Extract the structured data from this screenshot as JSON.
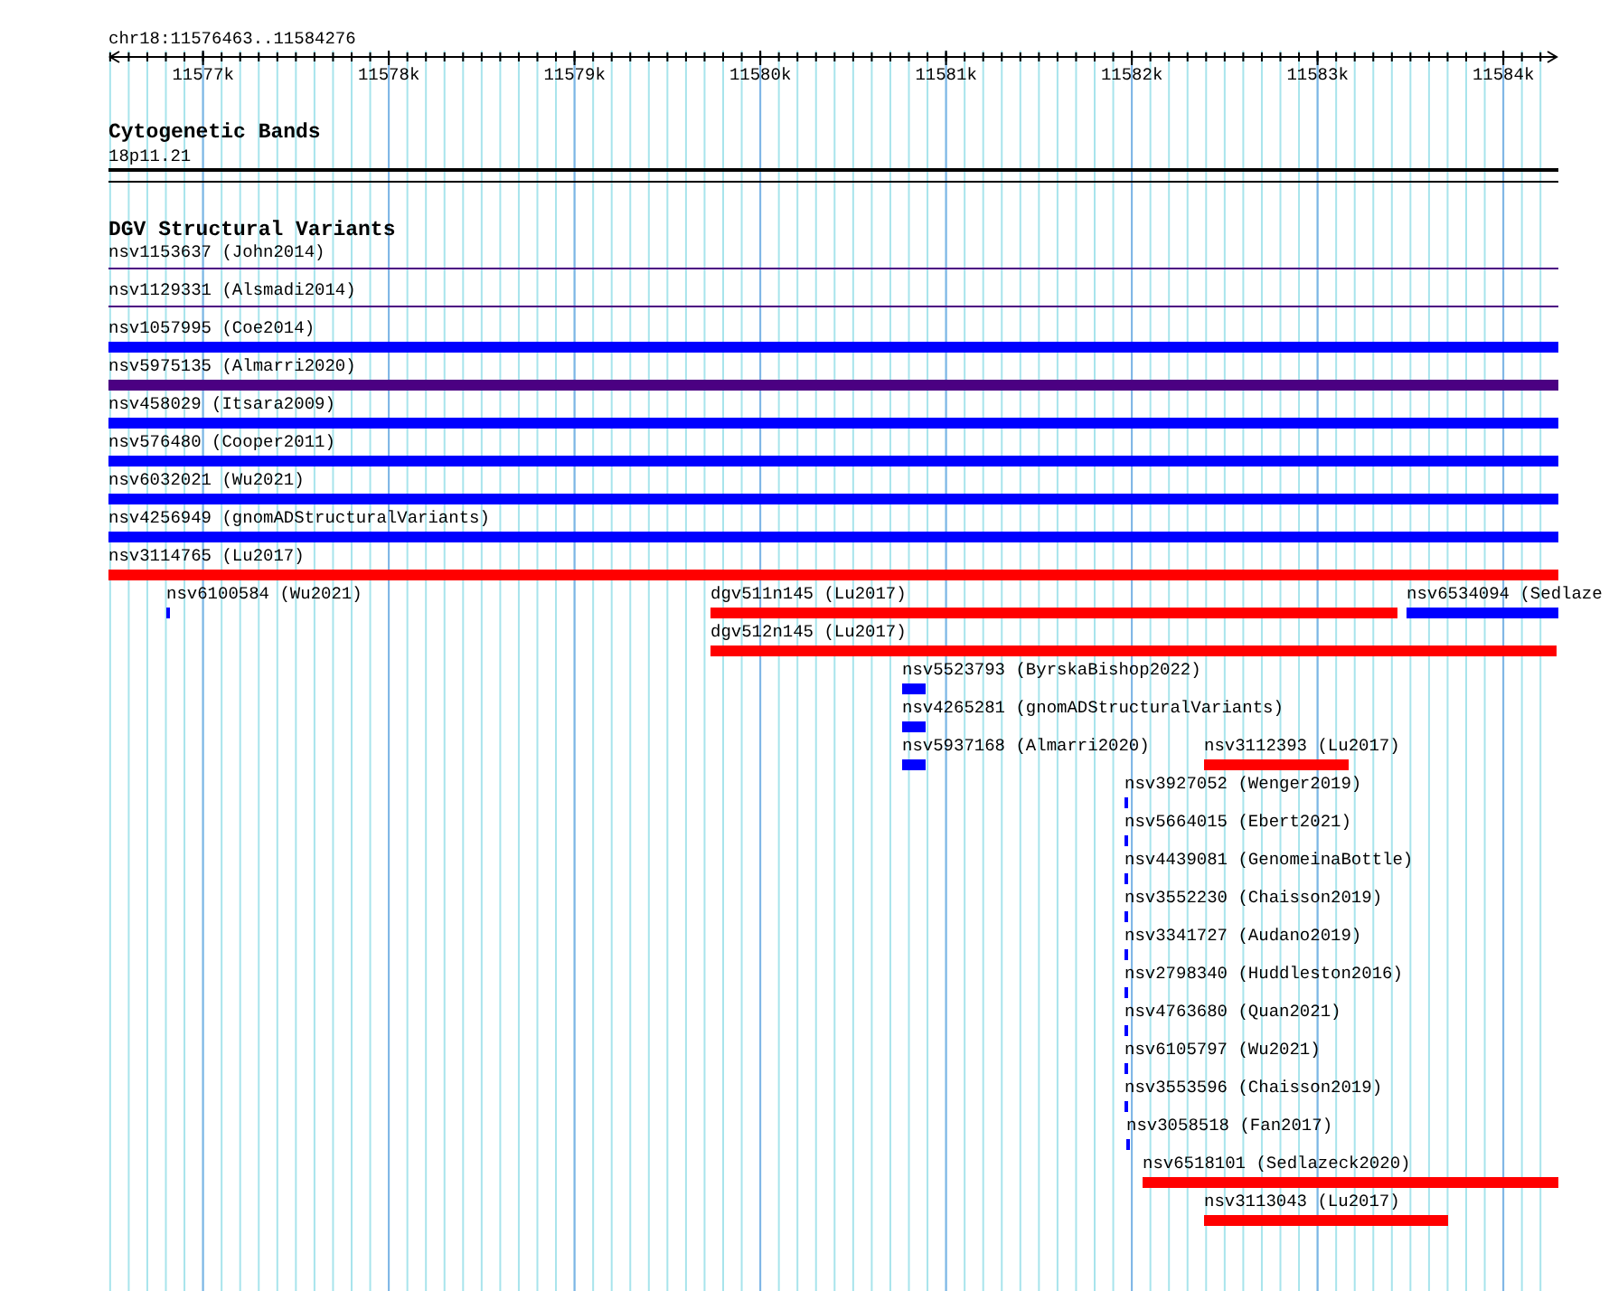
{
  "ruler": {
    "location": "chr18:11576463..11584276",
    "ticks": [
      "11577k",
      "11578k",
      "11579k",
      "11580k",
      "11581k",
      "11582k",
      "11583k",
      "11584k"
    ]
  },
  "cytoband_track": {
    "title": "Cytogenetic Bands",
    "band": "18p11.21"
  },
  "dgv_track": {
    "title": "DGV Structural Variants",
    "features": [
      {
        "label": "nsv1153637 (John2014)",
        "kind": "line",
        "color": "#4b0082"
      },
      {
        "label": "nsv1129331 (Alsmadi2014)",
        "kind": "line",
        "color": "#4b0082"
      },
      {
        "label": "nsv1057995 (Coe2014)",
        "kind": "bar",
        "color": "#0000ff"
      },
      {
        "label": "nsv5975135 (Almarri2020)",
        "kind": "bar",
        "color": "#4b0082"
      },
      {
        "label": "nsv458029 (Itsara2009)",
        "kind": "bar",
        "color": "#0000ff"
      },
      {
        "label": "nsv576480 (Cooper2011)",
        "kind": "bar",
        "color": "#0000ff"
      },
      {
        "label": "nsv6032021 (Wu2021)",
        "kind": "bar",
        "color": "#0000ff"
      },
      {
        "label": "nsv4256949 (gnomADStructuralVariants)",
        "kind": "bar",
        "color": "#0000ff"
      },
      {
        "label": "nsv3114765 (Lu2017)",
        "kind": "bar",
        "color": "#ff0000"
      },
      {
        "label": "nsv6100584 (Wu2021)",
        "kind": "bar",
        "color": "#0000ff"
      },
      {
        "label": "dgv511n145 (Lu2017)",
        "kind": "bar",
        "color": "#ff0000"
      },
      {
        "label": "nsv6534094 (Sedlaze",
        "kind": "bar",
        "color": "#0000ff"
      },
      {
        "label": "dgv512n145 (Lu2017)",
        "kind": "bar",
        "color": "#ff0000"
      },
      {
        "label": "nsv5523793 (ByrskaBishop2022)",
        "kind": "bar",
        "color": "#0000ff"
      },
      {
        "label": "nsv4265281 (gnomADStructuralVariants)",
        "kind": "bar",
        "color": "#0000ff"
      },
      {
        "label": "nsv5937168 (Almarri2020)",
        "kind": "bar",
        "color": "#0000ff"
      },
      {
        "label": "nsv3112393 (Lu2017)",
        "kind": "bar",
        "color": "#ff0000"
      },
      {
        "label": "nsv3927052 (Wenger2019)",
        "kind": "bar",
        "color": "#0000ff"
      },
      {
        "label": "nsv5664015 (Ebert2021)",
        "kind": "bar",
        "color": "#0000ff"
      },
      {
        "label": "nsv4439081 (GenomeinaBottle)",
        "kind": "bar",
        "color": "#0000ff"
      },
      {
        "label": "nsv3552230 (Chaisson2019)",
        "kind": "bar",
        "color": "#0000ff"
      },
      {
        "label": "nsv3341727 (Audano2019)",
        "kind": "bar",
        "color": "#0000ff"
      },
      {
        "label": "nsv2798340 (Huddleston2016)",
        "kind": "bar",
        "color": "#0000ff"
      },
      {
        "label": "nsv4763680 (Quan2021)",
        "kind": "bar",
        "color": "#0000ff"
      },
      {
        "label": "nsv6105797 (Wu2021)",
        "kind": "bar",
        "color": "#0000ff"
      },
      {
        "label": "nsv3553596 (Chaisson2019)",
        "kind": "bar",
        "color": "#0000ff"
      },
      {
        "label": "nsv3058518 (Fan2017)",
        "kind": "bar",
        "color": "#0000ff"
      },
      {
        "label": "nsv6518101 (Sedlazeck2020)",
        "kind": "bar",
        "color": "#ff0000"
      },
      {
        "label": "nsv3113043 (Lu2017)",
        "kind": "bar",
        "color": "#ff0000"
      }
    ]
  }
}
